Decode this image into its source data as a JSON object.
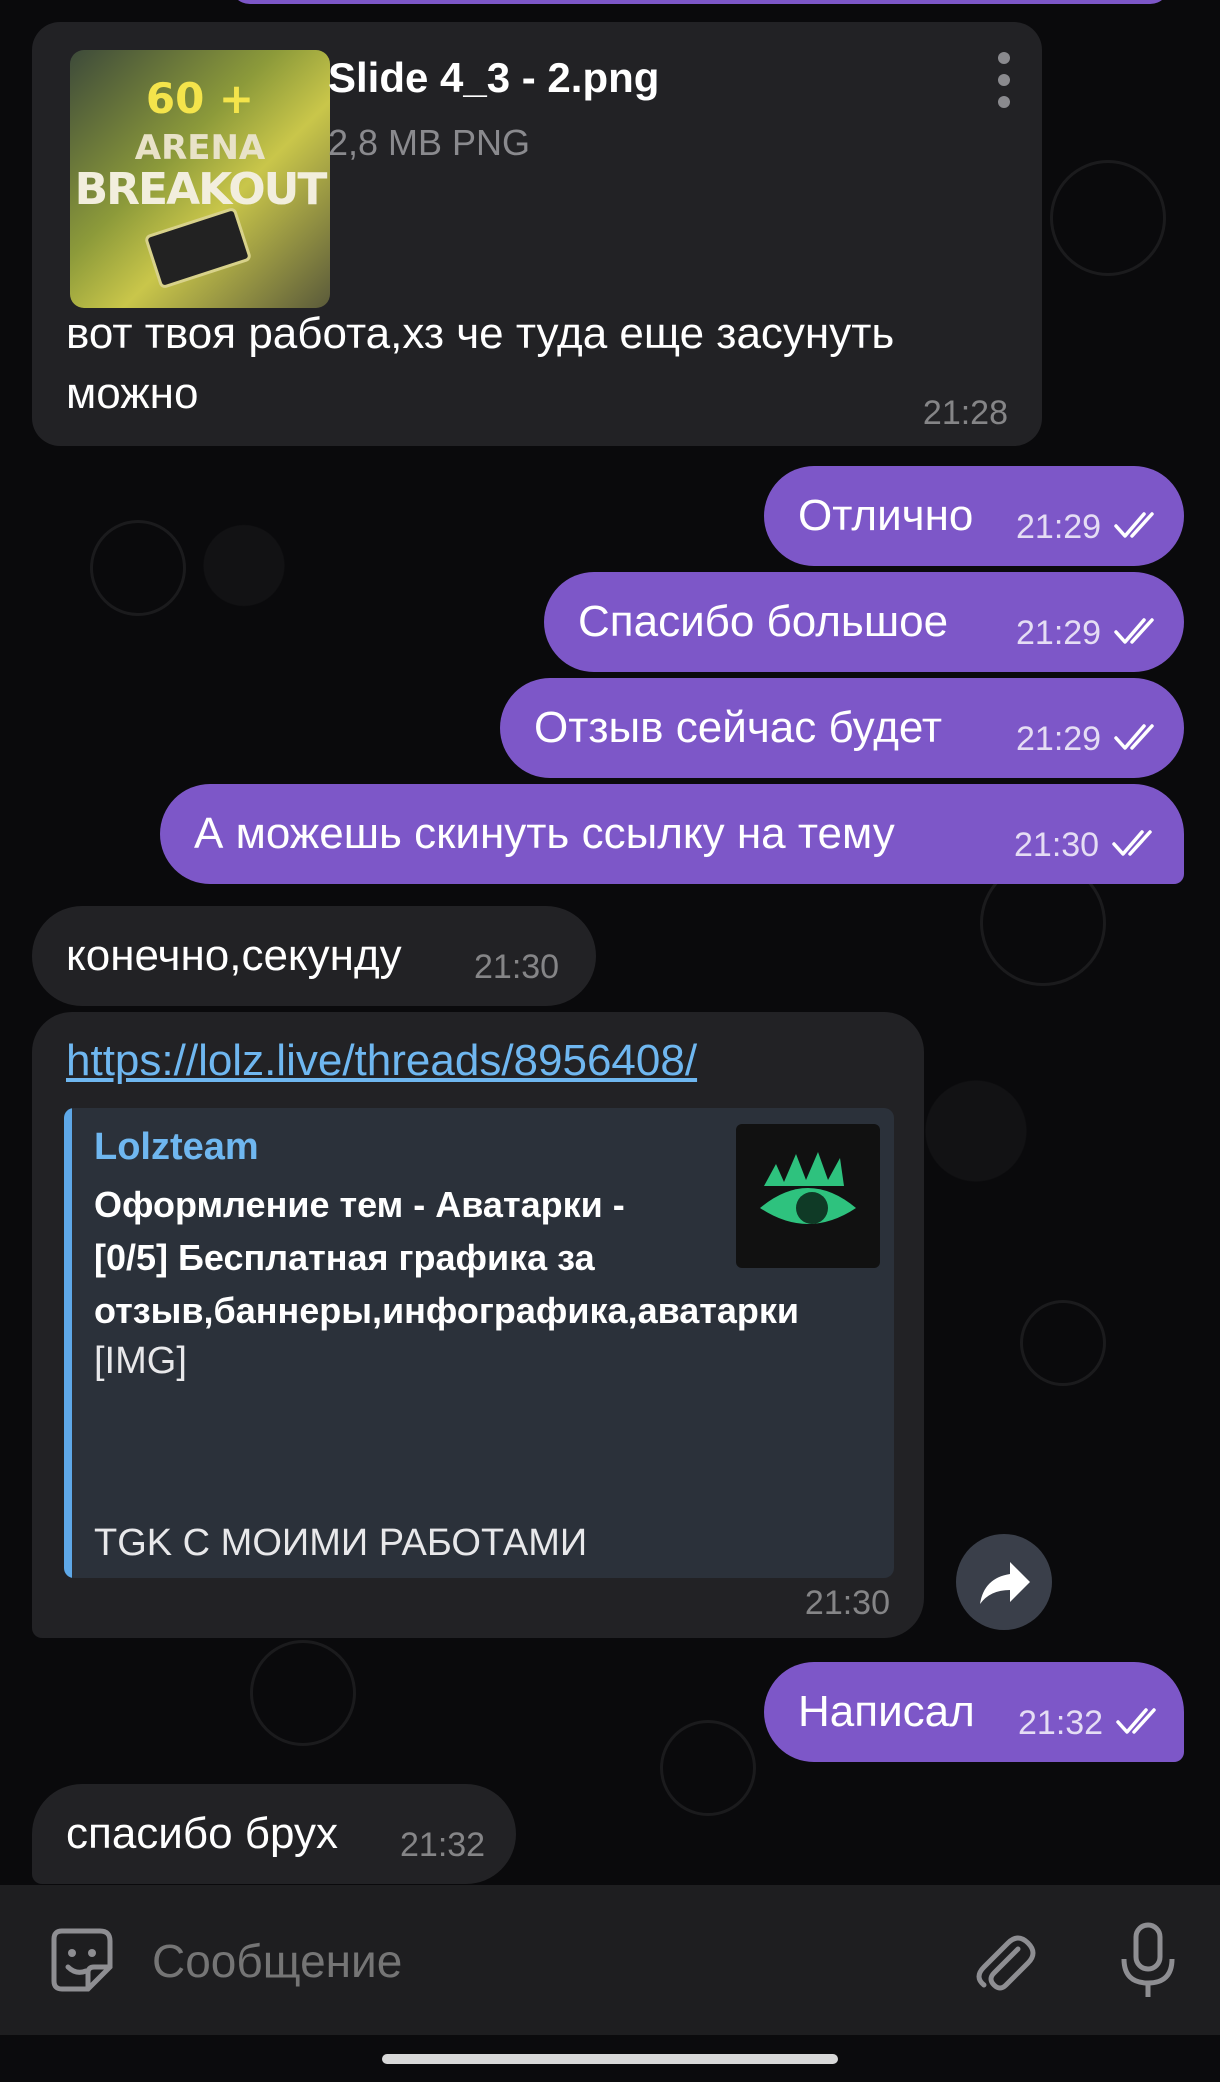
{
  "messages": {
    "file_message": {
      "file_name": "Slide 4_3 - 2.png",
      "file_meta": "2,8 MB PNG",
      "thumb_lines": [
        "60 +",
        "ARENA",
        "BREAKOUT"
      ],
      "text_line1": "вот твоя работа,хз че туда еще засунуть",
      "text_line2": "можно",
      "time": "21:28"
    },
    "out1": {
      "text": "Отлично",
      "time": "21:29"
    },
    "out2": {
      "text": "Спасибо большое",
      "time": "21:29"
    },
    "out3": {
      "text": "Отзыв сейчас будет",
      "time": "21:29"
    },
    "out4": {
      "text": "А можешь скинуть ссылку на тему",
      "time": "21:30"
    },
    "in1": {
      "text": "конечно,секунду",
      "time": "21:30"
    },
    "link_message": {
      "url": "https://lolz.live/threads/8956408/",
      "preview_site": "Lolzteam",
      "preview_title_lines": [
        "Оформление тем - Аватарки -",
        "[0/5] Бесплатная графика за",
        "отзыв,баннеры,инфографика,аватарки"
      ],
      "preview_img_tag": "[IMG]",
      "preview_footer": "TGK С МОИМИ РАБОТАМИ",
      "time": "21:30"
    },
    "out5": {
      "text": "Написал",
      "time": "21:32"
    },
    "in2": {
      "text": "спасибо брух",
      "time": "21:32"
    }
  },
  "input": {
    "placeholder": "Сообщение"
  },
  "icons": {
    "emoji": "sticker-emoji-icon",
    "attach": "paperclip-icon",
    "mic": "microphone-icon",
    "share": "forward-arrow-icon",
    "menu": "more-vertical-icon",
    "read": "double-check-icon"
  },
  "colors": {
    "outgoing_bubble": "#7d57c8",
    "incoming_bubble": "#222225",
    "link": "#6fb7f0"
  }
}
